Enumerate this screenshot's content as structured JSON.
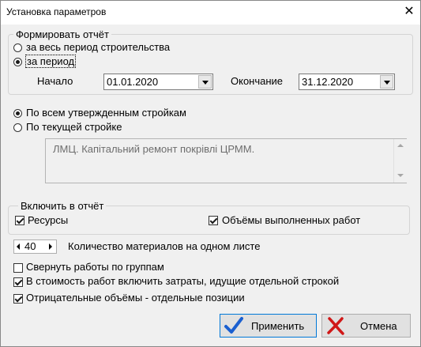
{
  "window": {
    "title": "Установка параметров",
    "close_glyph": "✕"
  },
  "report_group": {
    "legend": "Формировать отчёт",
    "option_whole": "за весь период строительства",
    "option_period": "за период",
    "selected": "period",
    "start_label": "Начало",
    "start_value": "01.01.2020",
    "end_label": "Окончание",
    "end_value": "31.12.2020"
  },
  "scope": {
    "option_all": "По всем утвержденным стройкам",
    "option_current": "По текущей стройке",
    "selected": "all",
    "current_text": "ЛМЦ. Капітальний ремонт покрівлі ЦРММ."
  },
  "include_group": {
    "legend": "Включить в отчёт",
    "resources_label": "Ресурсы",
    "resources_checked": true,
    "volumes_label": "Объёмы выполненных работ",
    "volumes_checked": true
  },
  "materials": {
    "count": "40",
    "label": "Количество материалов на одном листе"
  },
  "options": [
    {
      "label": "Свернуть работы по группам",
      "checked": false
    },
    {
      "label": "В стоимость работ включить затраты, идущие отдельной строкой",
      "checked": true
    },
    {
      "label": "Отрицательные объёмы - отдельные позиции",
      "checked": true
    }
  ],
  "buttons": {
    "apply_label": "Применить",
    "cancel_label": "Отмена",
    "apply_icon": "checkmark-icon",
    "cancel_icon": "cross-icon",
    "apply_color": "#1a5fd0",
    "cancel_color": "#d01818"
  }
}
